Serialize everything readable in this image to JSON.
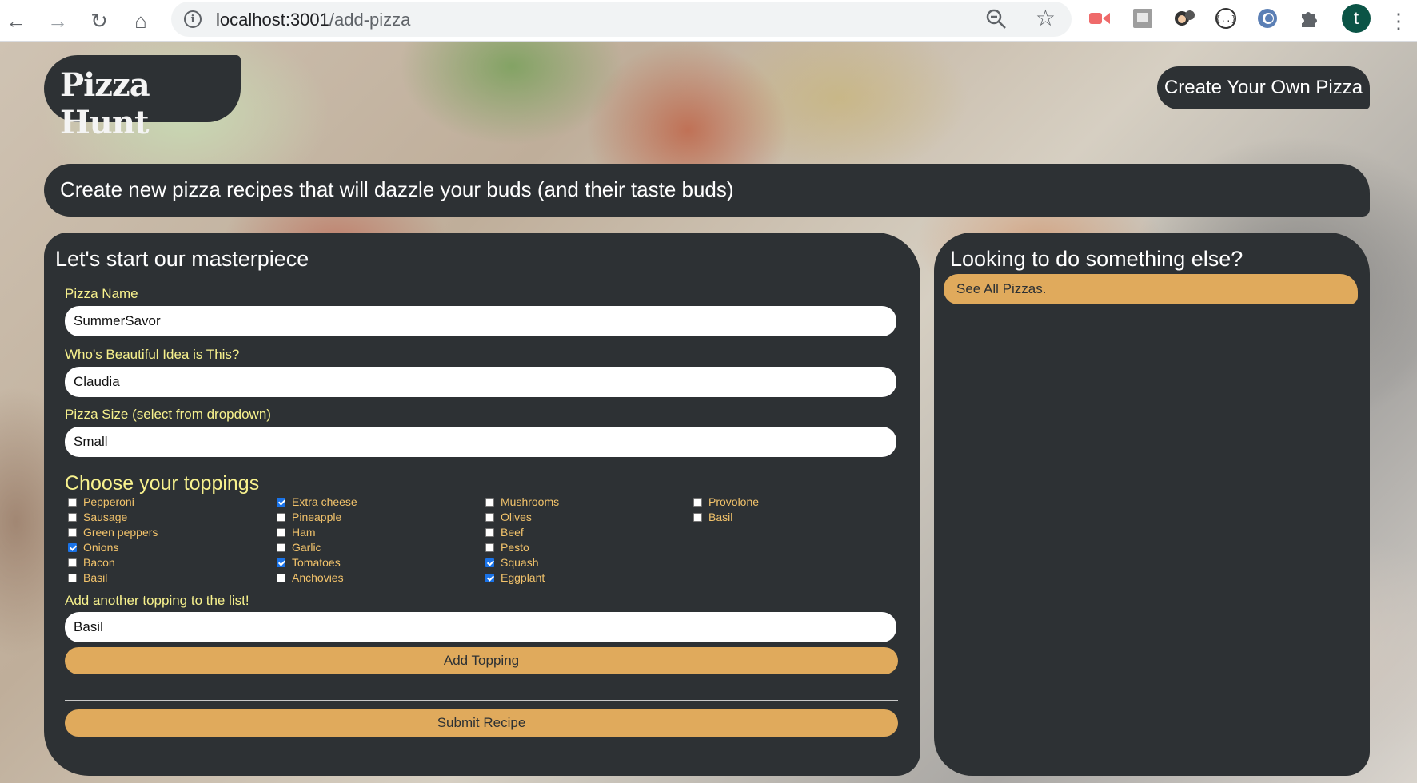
{
  "browser": {
    "url_host": "localhost:3001",
    "url_path": "/add-pizza",
    "avatar_letter": "t"
  },
  "header": {
    "logo_text": "Pizza Hunt",
    "create_button": "Create Your Own Pizza"
  },
  "banner": {
    "text": "Create new pizza recipes that will dazzle your buds (and their taste buds)"
  },
  "form": {
    "title": "Let's start our masterpiece",
    "pizza_name_label": "Pizza Name",
    "pizza_name_value": "SummerSavor",
    "creator_label": "Who's Beautiful Idea is This?",
    "creator_value": "Claudia",
    "size_label": "Pizza Size (select from dropdown)",
    "size_value": "Small",
    "toppings_title": "Choose your toppings",
    "toppings": [
      {
        "label": "Pepperoni",
        "checked": false
      },
      {
        "label": "Sausage",
        "checked": false
      },
      {
        "label": "Green peppers",
        "checked": false
      },
      {
        "label": "Onions",
        "checked": true
      },
      {
        "label": "Bacon",
        "checked": false
      },
      {
        "label": "Basil",
        "checked": false
      },
      {
        "label": "Extra cheese",
        "checked": true
      },
      {
        "label": "Pineapple",
        "checked": false
      },
      {
        "label": "Ham",
        "checked": false
      },
      {
        "label": "Garlic",
        "checked": false
      },
      {
        "label": "Tomatoes",
        "checked": true
      },
      {
        "label": "Anchovies",
        "checked": false
      },
      {
        "label": "Mushrooms",
        "checked": false
      },
      {
        "label": "Olives",
        "checked": false
      },
      {
        "label": "Beef",
        "checked": false
      },
      {
        "label": "Pesto",
        "checked": false
      },
      {
        "label": "Squash",
        "checked": true
      },
      {
        "label": "Eggplant",
        "checked": true
      },
      {
        "label": "Provolone",
        "checked": false
      },
      {
        "label": "Basil",
        "checked": false
      }
    ],
    "new_topping_label": "Add another topping to the list!",
    "new_topping_value": "Basil",
    "add_topping_button": "Add Topping",
    "submit_button": "Submit Recipe"
  },
  "sidebar": {
    "title": "Looking to do something else?",
    "see_all_button": "See All Pizzas."
  },
  "colors": {
    "panel": "#2d3134",
    "accent": "#e0aa5c",
    "label_yellow": "#f7f18d",
    "topping_text": "#f2c36b"
  }
}
